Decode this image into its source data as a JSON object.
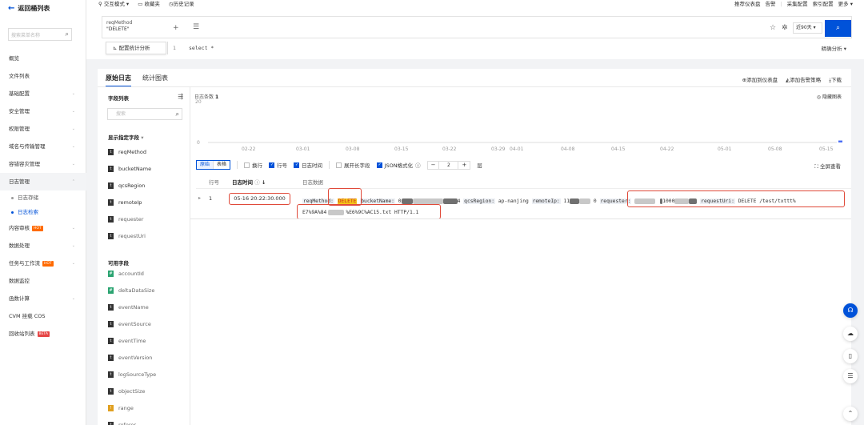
{
  "sidebar": {
    "back_label": "返回桶列表",
    "search_placeholder": "搜索菜单名称",
    "items": [
      {
        "label": "概览"
      },
      {
        "label": "文件列表"
      },
      {
        "label": "基础配置"
      },
      {
        "label": "安全管理"
      },
      {
        "label": "权限管理"
      },
      {
        "label": "域名与传输管理"
      },
      {
        "label": "容错容灾管理"
      },
      {
        "label": "日志管理"
      },
      {
        "label": "日志存储"
      },
      {
        "label": "日志检索"
      },
      {
        "label": "内容审核",
        "badge": "HOT"
      },
      {
        "label": "数据处理"
      },
      {
        "label": "任务与工作流",
        "badge": "HOT"
      },
      {
        "label": "数据监控"
      },
      {
        "label": "函数计算"
      },
      {
        "label": "CVM 挂载 COS"
      },
      {
        "label": "回收站列表",
        "badge": "BETA"
      }
    ]
  },
  "toolbar": {
    "interactive_mode": "交互模式",
    "favorites": "收藏夹",
    "history": "历史记录",
    "recommend_dashboard": "推荐仪表盘",
    "alarm": "告警",
    "collect_config": "采集配置",
    "index_config": "索引配置",
    "more": "更多"
  },
  "query": {
    "chip_key": "reqMethod",
    "chip_value": "\"DELETE\"",
    "time_range": "近90天",
    "config_stats": "配置统计分析",
    "line_no": "1",
    "sql": "select *",
    "precise_analysis": "精确分析"
  },
  "panel": {
    "tab_raw": "原始日志",
    "tab_chart": "统计图表",
    "add_dashboard": "添加到仪表盘",
    "add_alarm": "添加告警策略",
    "download": "下载",
    "field_list": "字段列表",
    "field_search": "搜索",
    "shown_fields_title": "显示指定字段",
    "shown_fields": [
      "reqMethod",
      "bucketName",
      "qcsRegion",
      "remoteIp",
      "requester",
      "requestUri"
    ],
    "available_title": "可用字段",
    "available_fields": [
      {
        "name": "accountId",
        "tag": "#"
      },
      {
        "name": "deltaDataSize",
        "tag": "#"
      },
      {
        "name": "eventName",
        "tag": "t"
      },
      {
        "name": "eventSource",
        "tag": "t"
      },
      {
        "name": "eventTime",
        "tag": "t"
      },
      {
        "name": "eventVersion",
        "tag": "t"
      },
      {
        "name": "logSourceType",
        "tag": "t"
      },
      {
        "name": "objectSize",
        "tag": "t"
      },
      {
        "name": "range",
        "tag": "!"
      },
      {
        "name": "referer",
        "tag": "t"
      }
    ]
  },
  "chart": {
    "count_label": "日志条数",
    "count_value": "1",
    "hide_chart": "隐藏图表",
    "y_max": "20",
    "y_min": "0"
  },
  "chart_data": {
    "type": "bar",
    "title": "日志条数 1",
    "categories": [
      "02-22",
      "03-01",
      "03-08",
      "03-15",
      "03-22",
      "03-29",
      "04-01",
      "04-08",
      "04-15",
      "04-22",
      "05-01",
      "05-08",
      "05-15"
    ],
    "values": [
      0,
      0,
      0,
      0,
      0,
      0,
      0,
      0,
      0,
      0,
      0,
      0,
      1
    ],
    "ylim": [
      0,
      20
    ],
    "xlabel": "",
    "ylabel": ""
  },
  "log_toolbar": {
    "raw": "原始",
    "table": "表格",
    "wrap": "换行",
    "line_no": "行号",
    "log_time": "日志时间",
    "expand_long": "展开长字段",
    "json_format": "JSON格式化",
    "level": "2",
    "level_unit": "层",
    "fullscreen": "全屏查看"
  },
  "table": {
    "col_line": "行号",
    "col_time": "日志时间",
    "col_data": "日志数据",
    "row_num": "1",
    "row_time": "05-16 20:22:30.000",
    "k_reqMethod": "reqMethod:",
    "v_reqMethod": "DELETE",
    "k_bucketName": "bucketName:",
    "v_bucket_prefix": "0",
    "v_bucket_suffix": "4",
    "k_qcsRegion": "qcsRegion:",
    "v_qcsRegion": "ap-nanjing",
    "k_remoteIp": "remoteIp:",
    "v_remoteIp": "11",
    "v_remote_tail": "0",
    "k_requester": "requester:",
    "v_requester_mid": "1000",
    "k_requestUri": "requestUri:",
    "v_requestUri": "DELETE /test/txttt%",
    "v_uri_line2_a": "E7%9A%84",
    "v_uri_line2_b": "%E6%9C%AC15.txt HTTP/1.1"
  },
  "colors": {
    "accent": "#0052d9",
    "highlight_box": "#e04a3a",
    "hot_badge": "#ff6a00"
  }
}
